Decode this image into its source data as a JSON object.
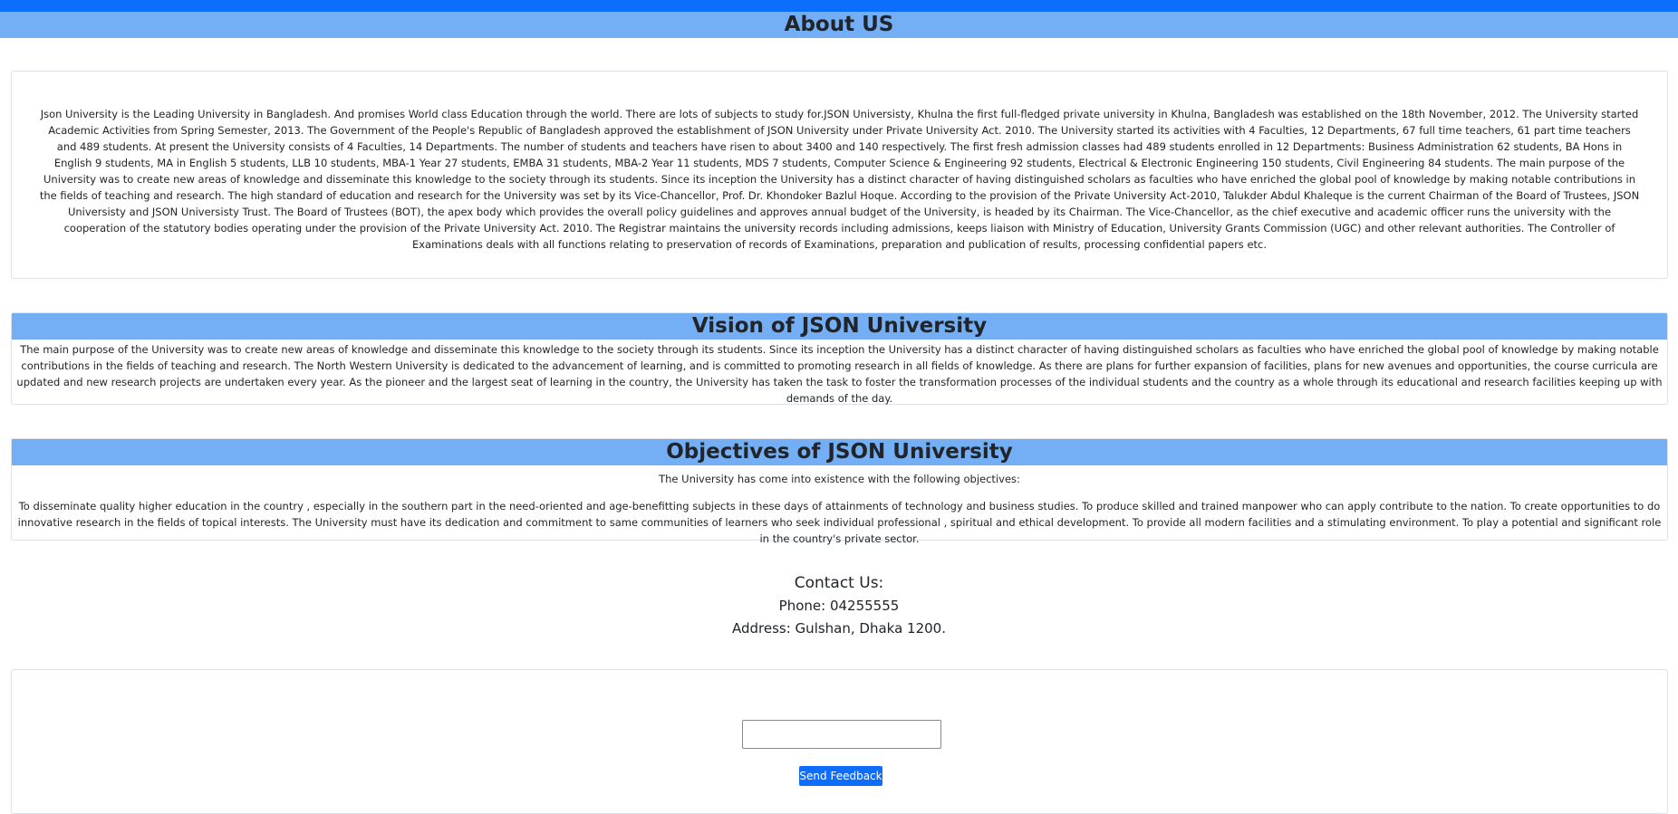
{
  "colors": {
    "topbar": "#0d6efd",
    "heading_band": "#74aef4",
    "button": "#0d6efd"
  },
  "about": {
    "title": "About US",
    "text": "Json University is the Leading University in Bangladesh. And promises World class Education through the world. There are lots of subjects to study for.JSON Universisty, Khulna the first full-fledged private university in Khulna, Bangladesh was established on the 18th November, 2012. The University started Academic Activities from Spring Semester, 2013. The Government of the People's Republic of Bangladesh approved the establishment of JSON University under Private University Act. 2010. The University started its activities with 4 Faculties, 12 Departments, 67 full time teachers, 61 part time teachers and 489 students. At present the University consists of 4 Faculties, 14 Departments. The number of students and teachers have risen to about 3400 and 140 respectively. The first fresh admission classes had 489 students enrolled in 12 Departments: Business Administration 62 students, BA Hons in English 9 students, MA in English 5 students, LLB 10 students, MBA-1 Year 27 students, EMBA 31 students, MBA-2 Year 11 students, MDS 7 students, Computer Science & Engineering 92 students, Electrical & Electronic Engineering 150 students, Civil Engineering 84 students. The main purpose of the University was to create new areas of knowledge and disseminate this knowledge to the society through its students. Since its inception the University has a distinct character of having distinguished scholars as faculties who have enriched the global pool of knowledge by making notable contributions in the fields of teaching and research. The high standard of education and research for the University was set by its Vice-Chancellor, Prof. Dr. Khondoker Bazlul Hoque. According to the provision of the Private University Act-2010, Talukder Abdul Khaleque is the current Chairman of the Board of Trustees, JSON Universisty and JSON Universisty Trust. The Board of Trustees (BOT), the apex body which provides the overall policy guidelines and approves annual budget of the University, is headed by its Chairman. The Vice-Chancellor, as the chief executive and academic officer runs the university with the cooperation of the statutory bodies operating under the provision of the Private University Act. 2010. The Registrar maintains the university records including admissions, keeps liaison with Ministry of Education, University Grants Commission (UGC) and other relevant authorities. The Controller of Examinations deals with all functions relating to preservation of records of Examinations, preparation and publication of results, processing confidential papers etc."
  },
  "vision": {
    "title": "Vision of JSON University",
    "text": "The main purpose of the University was to create new areas of knowledge and disseminate this knowledge to the society through its students. Since its inception the University has a distinct character of having distinguished scholars as faculties who have enriched the global pool of knowledge by making notable contributions in the fields of teaching and research. The North Western University is dedicated to the advancement of learning, and is committed to promoting research in all fields of knowledge. As there are plans for further expansion of facilities, plans for new avenues and opportunities, the course curricula are updated and new research projects are undertaken every year. As the pioneer and the largest seat of learning in the country, the University has taken the task to foster the transformation processes of the individual students and the country as a whole through its educational and research facilities keeping up with demands of the day."
  },
  "objectives": {
    "title": "Objectives of JSON University",
    "intro": "The University has come into existence with the following objectives:",
    "text": "To disseminate quality higher education in the country , especially in the southern part in the need-oriented and age-benefitting subjects in these days of attainments of technology and business studies. To produce skilled and trained manpower who can apply contribute to the nation. To create opportunities to do innovative research in the fields of topical interests. The University must have its dedication and commitment to same communities of learners who seek individual professional , spiritual and ethical development. To provide all modern facilities and a stimulating environment. To play a potential and significant role in the country's private sector."
  },
  "contact": {
    "title": "Contact Us:",
    "phone": "Phone: 04255555",
    "address": "Address: Gulshan, Dhaka 1200."
  },
  "feedback": {
    "input_value": "",
    "button_label": "Send Feedback"
  }
}
